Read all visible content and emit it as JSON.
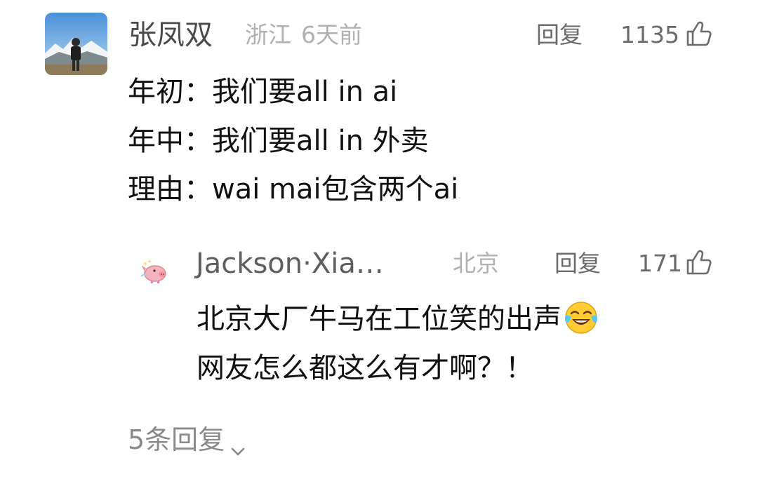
{
  "comment": {
    "author": "张凤双",
    "location": "浙江",
    "time": "6天前",
    "reply_label": "回复",
    "likes": "1135",
    "lines": [
      "年初：我们要all in ai",
      "年中：我们要all in 外卖",
      "理由：wai mai包含两个ai"
    ]
  },
  "reply": {
    "author": "Jackson·Xia…",
    "location": "北京",
    "reply_label": "回复",
    "likes": "171",
    "line1": "北京大厂牛马在工位笑的出声",
    "emoji": "tears-of-joy-emoji",
    "line2": "网友怎么都这么有才啊？！"
  },
  "more_replies_label": "5条回复",
  "icons": {
    "like": "thumbs-up-icon",
    "expand": "chevron-down-icon"
  },
  "colors": {
    "name": "#4a4a4a",
    "meta": "#b1b1b1",
    "body_text": "#111111",
    "action": "#6b6b6b"
  }
}
